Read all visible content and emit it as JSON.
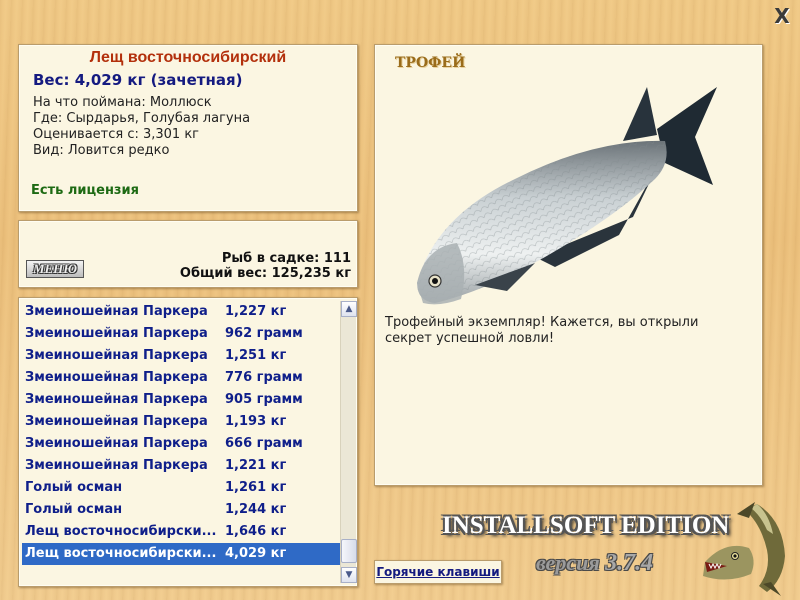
{
  "close_glyph": "X",
  "info": {
    "fish_name": "Лещ восточносибирский",
    "weight": "Вес: 4,029 кг (зачетная)",
    "caught_with": "На что поймана: Моллюск",
    "location": "Где: Сырдарья, Голубая лагуна",
    "valued_from": "Оценивается с: 3,301 кг",
    "rarity": "Вид: Ловится редко",
    "license": "Есть лицензия"
  },
  "cage": {
    "menu_label": "МЕНЮ",
    "fish_count": "Рыб в садке: 111",
    "total_weight": "Общий вес: 125,235 кг"
  },
  "catch_list": {
    "selected_index": 11,
    "rows": [
      {
        "name": "Змеиношейная Паркера",
        "weight": "1,227 кг"
      },
      {
        "name": "Змеиношейная Паркера",
        "weight": "962 грамм"
      },
      {
        "name": "Змеиношейная Паркера",
        "weight": "1,251 кг"
      },
      {
        "name": "Змеиношейная Паркера",
        "weight": "776 грамм"
      },
      {
        "name": "Змеиношейная Паркера",
        "weight": "905 грамм"
      },
      {
        "name": "Змеиношейная Паркера",
        "weight": "1,193 кг"
      },
      {
        "name": "Змеиношейная Паркера",
        "weight": "666 грамм"
      },
      {
        "name": "Змеиношейная Паркера",
        "weight": "1,221 кг"
      },
      {
        "name": "Голый осман",
        "weight": "1,261 кг"
      },
      {
        "name": "Голый осман",
        "weight": "1,244 кг"
      },
      {
        "name": "Лещ восточносибирски...",
        "weight": "1,646 кг"
      },
      {
        "name": "Лещ восточносибирски...",
        "weight": "4,029 кг"
      }
    ],
    "scroll_up_glyph": "▲",
    "scroll_down_glyph": "▼"
  },
  "trophy": {
    "title": "ТРОФЕЙ",
    "text": "Трофейный экземпляр! Кажется, вы открыли секрет успешной ловли!"
  },
  "hotkeys_label": "Горячие клавиши",
  "edition": "INSTALLSOFT EDITION",
  "version_word": "версия",
  "version_number": "3.7.4",
  "colors": {
    "fish_name": "#b3300c",
    "weight": "#141a80",
    "license": "#1d6a13",
    "list_text": "#0f1f8a",
    "selection": "#2f6ac6",
    "trophy_title": "#9a6c1a"
  },
  "icons": [
    "close-icon",
    "bream-fish-image",
    "pike-fish-logo",
    "scroll-up-icon",
    "scroll-down-icon"
  ]
}
